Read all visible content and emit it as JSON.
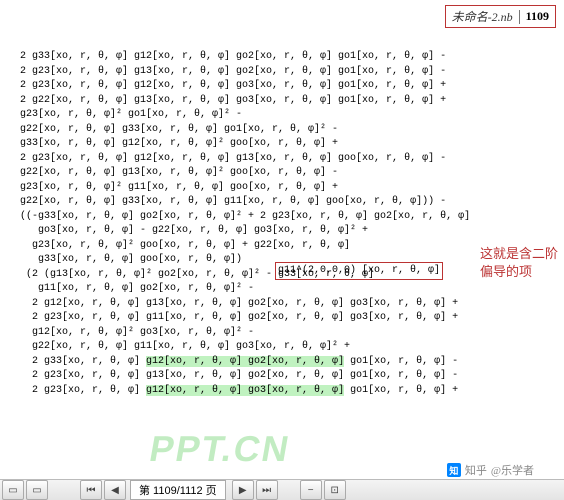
{
  "header": {
    "title": "未命名-2.nb",
    "page": "1109"
  },
  "annotation": {
    "boxed_term": "g11^(2,0,0,0) [xo, r, θ, φ]",
    "label_l1": "这就是含二阶",
    "label_l2": "偏导的项"
  },
  "lines": [
    "2 g33[xo, r, θ, φ] g12[xo, r, θ, φ] go2[xo, r, θ, φ] go1[xo, r, θ, φ] -",
    "2 g23[xo, r, θ, φ] g13[xo, r, θ, φ] go2[xo, r, θ, φ] go1[xo, r, θ, φ] -",
    "2 g23[xo, r, θ, φ] g12[xo, r, θ, φ] go3[xo, r, θ, φ] go1[xo, r, θ, φ] +",
    "2 g22[xo, r, θ, φ] g13[xo, r, θ, φ] go3[xo, r, θ, φ] go1[xo, r, θ, φ] +",
    "g23[xo, r, θ, φ]² go1[xo, r, θ, φ]² -",
    "g22[xo, r, θ, φ] g33[xo, r, θ, φ] go1[xo, r, θ, φ]² -",
    "g33[xo, r, θ, φ] g12[xo, r, θ, φ]² goo[xo, r, θ, φ] +",
    "2 g23[xo, r, θ, φ] g12[xo, r, θ, φ] g13[xo, r, θ, φ] goo[xo, r, θ, φ] -",
    "g22[xo, r, θ, φ] g13[xo, r, θ, φ]² goo[xo, r, θ, φ] -",
    "g23[xo, r, θ, φ]² g11[xo, r, θ, φ] goo[xo, r, θ, φ] +",
    "g22[xo, r, θ, φ] g33[xo, r, θ, φ] g11[xo, r, θ, φ] goo[xo, r, θ, φ])) -",
    "((-g33[xo, r, θ, φ] go2[xo, r, θ, φ]² + 2 g23[xo, r, θ, φ] go2[xo, r, θ, φ]",
    "   go3[xo, r, θ, φ] - g22[xo, r, θ, φ] go3[xo, r, θ, φ]² +",
    "  g23[xo, r, θ, φ]² goo[xo, r, θ, φ] + g22[xo, r, θ, φ]",
    "   g33[xo, r, θ, φ] goo[xo, r, θ, φ])",
    " (2 (g13[xo, r, θ, φ]² go2[xo, r, θ, φ]² - g33[xo, r, θ, φ]",
    "   g11[xo, r, θ, φ] go2[xo, r, θ, φ]² -",
    "  2 g12[xo, r, θ, φ] g13[xo, r, θ, φ] go2[xo, r, θ, φ] go3[xo, r, θ, φ] +",
    "  2 g23[xo, r, θ, φ] g11[xo, r, θ, φ] go2[xo, r, θ, φ] go3[xo, r, θ, φ] +",
    "  g12[xo, r, θ, φ]² go3[xo, r, θ, φ]² -",
    "  g22[xo, r, θ, φ] g11[xo, r, θ, φ] go3[xo, r, θ, φ]² +",
    "  2 g33[xo, r, θ, φ] g12[xo, r, θ, φ] go2[xo, r, θ, φ] go1[xo, r, θ, φ] -",
    "  2 g23[xo, r, θ, φ] g13[xo, r, θ, φ] go2[xo, r, θ, φ] go1[xo, r, θ, φ] -",
    "  2 g23[xo, r, θ, φ] g12[xo, r, θ, φ] go3[xo, r, θ, φ] go1[xo, r, θ, φ] +"
  ],
  "statusbar": {
    "page_text": "第 1109/1112 页"
  },
  "watermark": "PPT.CN",
  "zhihu": {
    "site": "知乎",
    "user": "@乐学者"
  }
}
